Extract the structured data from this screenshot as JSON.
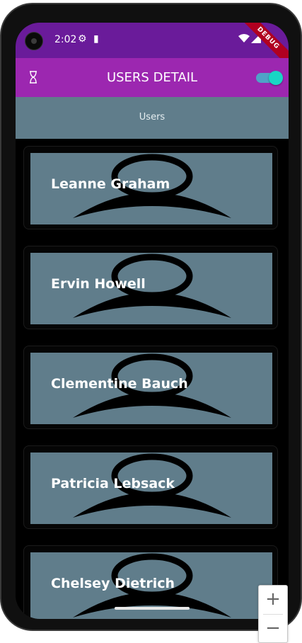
{
  "status_bar": {
    "time": "2:02",
    "debug_banner": "DEBUG",
    "gear_icon": "⚙",
    "sd_icon": "▮",
    "wifi_icon": "▾",
    "signal_icon": "◢"
  },
  "app_bar": {
    "title": "USERS DETAIL",
    "leading_icon": "hourglass-icon",
    "theme_toggle_on": true
  },
  "tabs": [
    {
      "label": "Users"
    }
  ],
  "users": [
    {
      "name": "Leanne Graham"
    },
    {
      "name": "Ervin Howell"
    },
    {
      "name": "Clementine Bauch"
    },
    {
      "name": "Patricia Lebsack"
    },
    {
      "name": "Chelsey Dietrich"
    }
  ],
  "zoom_controls": {
    "zoom_in": "+",
    "zoom_out": "−"
  },
  "colors": {
    "status_bar": "#6a1b9a",
    "app_bar": "#9c27b0",
    "tab_bar": "#607d8b",
    "card_image": "#607d8b",
    "toggle_thumb": "#19d6c4"
  }
}
